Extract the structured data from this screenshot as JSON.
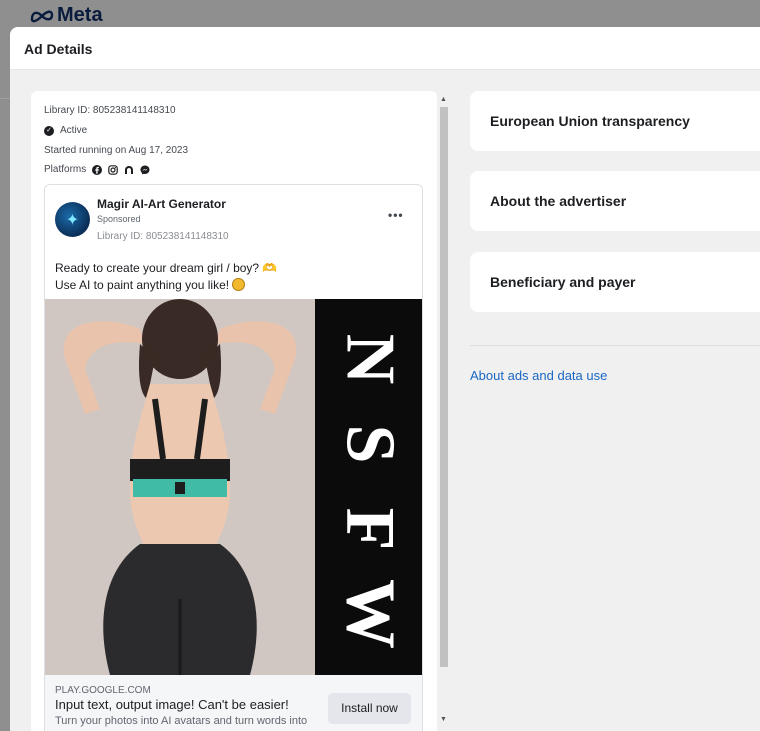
{
  "app": {
    "logo_text": "Meta"
  },
  "modal": {
    "title": "Ad Details"
  },
  "ad_summary": {
    "library_id": "Library ID: 805238141148310",
    "status": "Active",
    "started": "Started running on Aug 17, 2023",
    "platforms_label": "Platforms",
    "platform_icons": [
      "facebook-icon",
      "instagram-icon",
      "audience-network-icon",
      "messenger-icon"
    ]
  },
  "ad_card": {
    "advertiser": "Magir AI-Art Generator",
    "sponsored": "Sponsored",
    "library_id": "Library ID: 805238141148310",
    "more_label": "•••",
    "body_line_1": "Ready to create your dream girl / boy? 🫶",
    "body_line_2": "Use AI to paint anything you like!",
    "creative_text": [
      "N",
      "S",
      "F",
      "W"
    ],
    "domain": "PLAY.GOOGLE.COM",
    "headline": "Input text, output image! Can't be easier!",
    "description": "Turn your photos into AI avatars and turn words into",
    "cta_label": "Install now"
  },
  "right_panel": {
    "sections": [
      "European Union transparency",
      "About the advertiser",
      "Beneficiary and payer"
    ],
    "link": "About ads and data use"
  },
  "colors": {
    "link": "#1a67c2",
    "modal_bg": "#f0f0f0",
    "overlay": "#8f8f8f"
  }
}
